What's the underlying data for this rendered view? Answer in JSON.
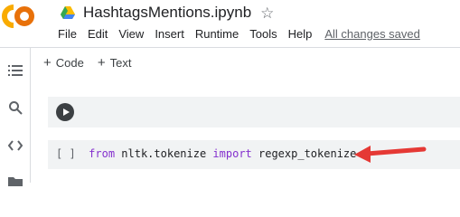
{
  "header": {
    "logo_text": "CO",
    "title": "HashtagsMentions.ipynb",
    "star_icon": "star-outline-icon"
  },
  "menu": {
    "items": [
      "File",
      "Edit",
      "View",
      "Insert",
      "Runtime",
      "Tools",
      "Help"
    ],
    "save_status": "All changes saved"
  },
  "sidebar": {
    "icons": [
      "table-of-contents-icon",
      "search-icon",
      "code-snippets-icon",
      "files-icon"
    ]
  },
  "toolbar": {
    "add_code_label": "Code",
    "add_text_label": "Text"
  },
  "cells": [
    {
      "type": "code",
      "source": "",
      "run_icon": "play-icon"
    },
    {
      "type": "code",
      "exec_count": "[ ]",
      "tokens": [
        {
          "text": "from",
          "kind": "keyword"
        },
        {
          "text": " nltk.tokenize ",
          "kind": "plain"
        },
        {
          "text": "import",
          "kind": "keyword"
        },
        {
          "text": " regexp_tokenize",
          "kind": "plain"
        }
      ]
    }
  ],
  "annotation": {
    "icon": "red-arrow-icon",
    "color": "#e53935"
  },
  "colors": {
    "logo_orange": "#f9ab00",
    "keyword": "#8430ce",
    "cell_bg": "#f1f3f4"
  }
}
